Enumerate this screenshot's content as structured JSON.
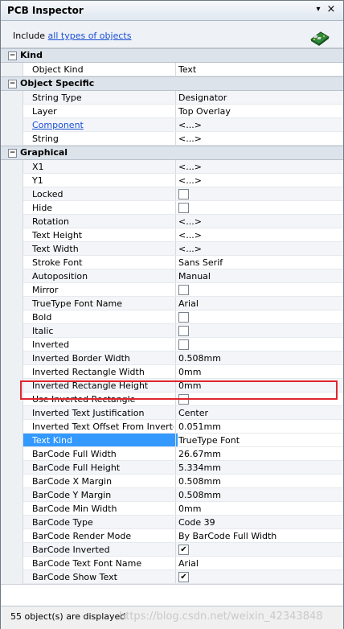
{
  "window": {
    "title": "PCB Inspector",
    "pin_glyph": "▾",
    "close_glyph": "×"
  },
  "filter": {
    "prefix": "Include",
    "link": "all types of objects"
  },
  "sections": [
    {
      "label": "Kind",
      "rows": [
        {
          "name": "Object Kind",
          "value": "Text",
          "type": "text"
        }
      ]
    },
    {
      "label": "Object Specific",
      "rows": [
        {
          "name": "String Type",
          "value": "Designator",
          "type": "text"
        },
        {
          "name": "Layer",
          "value": "Top Overlay",
          "type": "text"
        },
        {
          "name": "Component",
          "value": "<...>",
          "type": "text",
          "link": true
        },
        {
          "name": "String",
          "value": "<...>",
          "type": "text"
        }
      ]
    },
    {
      "label": "Graphical",
      "rows": [
        {
          "name": "X1",
          "value": "<...>",
          "type": "text"
        },
        {
          "name": "Y1",
          "value": "<...>",
          "type": "text"
        },
        {
          "name": "Locked",
          "value": "",
          "type": "check",
          "checked": false
        },
        {
          "name": "Hide",
          "value": "",
          "type": "check",
          "checked": false
        },
        {
          "name": "Rotation",
          "value": "<...>",
          "type": "text"
        },
        {
          "name": "Text Height",
          "value": "<...>",
          "type": "text"
        },
        {
          "name": "Text Width",
          "value": "<...>",
          "type": "text"
        },
        {
          "name": "Stroke Font",
          "value": "Sans Serif",
          "type": "text"
        },
        {
          "name": "Autoposition",
          "value": "Manual",
          "type": "text"
        },
        {
          "name": "Mirror",
          "value": "",
          "type": "check",
          "checked": false
        },
        {
          "name": "TrueType Font Name",
          "value": "Arial",
          "type": "text"
        },
        {
          "name": "Bold",
          "value": "",
          "type": "check",
          "checked": false
        },
        {
          "name": "Italic",
          "value": "",
          "type": "check",
          "checked": false
        },
        {
          "name": "Inverted",
          "value": "",
          "type": "check",
          "checked": false
        },
        {
          "name": "Inverted Border Width",
          "value": "0.508mm",
          "type": "text"
        },
        {
          "name": "Inverted Rectangle Width",
          "value": "0mm",
          "type": "text"
        },
        {
          "name": "Inverted Rectangle Height",
          "value": "0mm",
          "type": "text"
        },
        {
          "name": "Use Inverted Rectangle",
          "value": "",
          "type": "check",
          "checked": false
        },
        {
          "name": "Inverted Text Justification",
          "value": "Center",
          "type": "text"
        },
        {
          "name": "Inverted Text Offset From Inverte...",
          "value": "0.051mm",
          "type": "text"
        },
        {
          "name": "Text Kind",
          "value": "TrueType Font",
          "type": "text",
          "selected": true
        },
        {
          "name": "BarCode Full Width",
          "value": "26.67mm",
          "type": "text"
        },
        {
          "name": "BarCode Full Height",
          "value": "5.334mm",
          "type": "text"
        },
        {
          "name": "BarCode X Margin",
          "value": "0.508mm",
          "type": "text"
        },
        {
          "name": "BarCode Y Margin",
          "value": "0.508mm",
          "type": "text"
        },
        {
          "name": "BarCode Min Width",
          "value": "0mm",
          "type": "text"
        },
        {
          "name": "BarCode Type",
          "value": "Code 39",
          "type": "text"
        },
        {
          "name": "BarCode Render Mode",
          "value": "By BarCode Full Width",
          "type": "text"
        },
        {
          "name": "BarCode Inverted",
          "value": "",
          "type": "check",
          "checked": true
        },
        {
          "name": "BarCode Text Font Name",
          "value": "Arial",
          "type": "text"
        },
        {
          "name": "BarCode Show Text",
          "value": "",
          "type": "check",
          "checked": true
        }
      ]
    }
  ],
  "status": {
    "text": "55 object(s) are displayed",
    "watermark": "https://blog.csdn.net/weixin_42343848"
  },
  "colors": {
    "selection": "#3399ff",
    "highlight_box": "#e0262d",
    "link": "#1a4fd6"
  },
  "icons": {
    "panel_icon": "pcb-board-icon",
    "expander": "minus-box-icon"
  }
}
